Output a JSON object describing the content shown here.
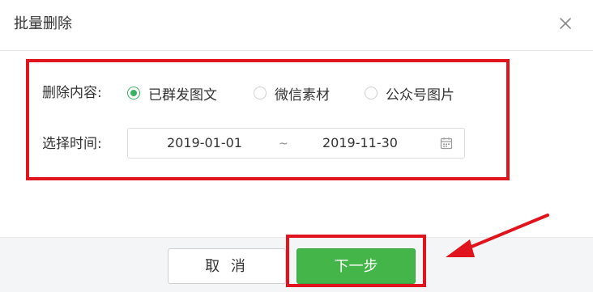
{
  "dialog": {
    "title": "批量删除",
    "close_icon": "close-icon"
  },
  "delete_content": {
    "label": "删除内容:",
    "options": [
      {
        "label": "已群发图文",
        "checked": true
      },
      {
        "label": "微信素材",
        "checked": false
      },
      {
        "label": "公众号图片",
        "checked": false
      }
    ]
  },
  "time_range": {
    "label": "选择时间:",
    "start": "2019-01-01",
    "separator": "~",
    "end": "2019-11-30",
    "icon": "calendar-icon"
  },
  "footer": {
    "cancel_label": "取 消",
    "next_label": "下一步"
  },
  "colors": {
    "accent_green": "#44b549",
    "annotation_red": "#e0141c"
  }
}
